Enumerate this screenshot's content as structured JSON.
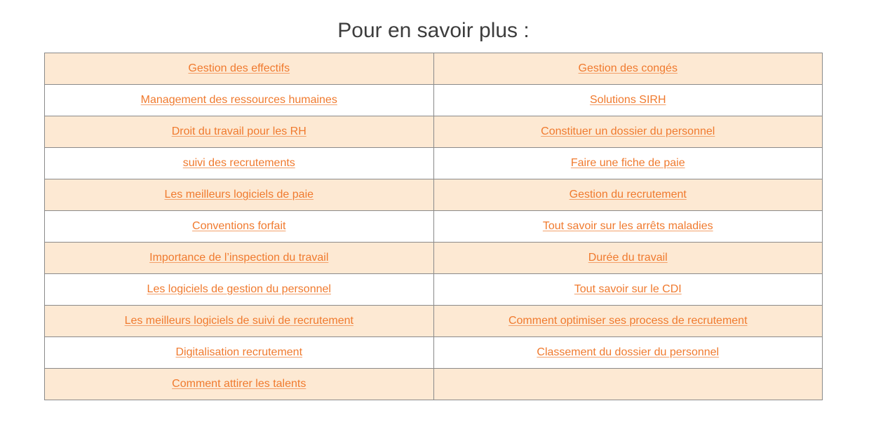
{
  "heading": "Pour en savoir plus :",
  "rows": [
    [
      "Gestion des effectifs",
      "Gestion des congés"
    ],
    [
      "Management des ressources humaines",
      "Solutions SIRH"
    ],
    [
      "Droit du travail pour les RH",
      "Constituer un dossier du personnel"
    ],
    [
      "suivi des recrutements",
      "Faire une fiche de paie"
    ],
    [
      "Les meilleurs logiciels de paie",
      "Gestion du recrutement"
    ],
    [
      "Conventions forfait",
      "Tout savoir sur les arrêts maladies"
    ],
    [
      "Importance de l’inspection du travail",
      "Durée du travail"
    ],
    [
      "Les logiciels de gestion du personnel",
      "Tout savoir sur le CDI"
    ],
    [
      "Les meilleurs logiciels de suivi de recrutement",
      "Comment optimiser ses process de recrutement"
    ],
    [
      "Digitalisation recrutement",
      "Classement du dossier du personnel"
    ],
    [
      "Comment attirer les talents",
      ""
    ]
  ],
  "colors": {
    "link": "#f07a2e",
    "row_shaded": "#fde9d3",
    "row_plain": "#ffffff",
    "border": "#8a8a8a",
    "heading": "#3d3d3d"
  }
}
